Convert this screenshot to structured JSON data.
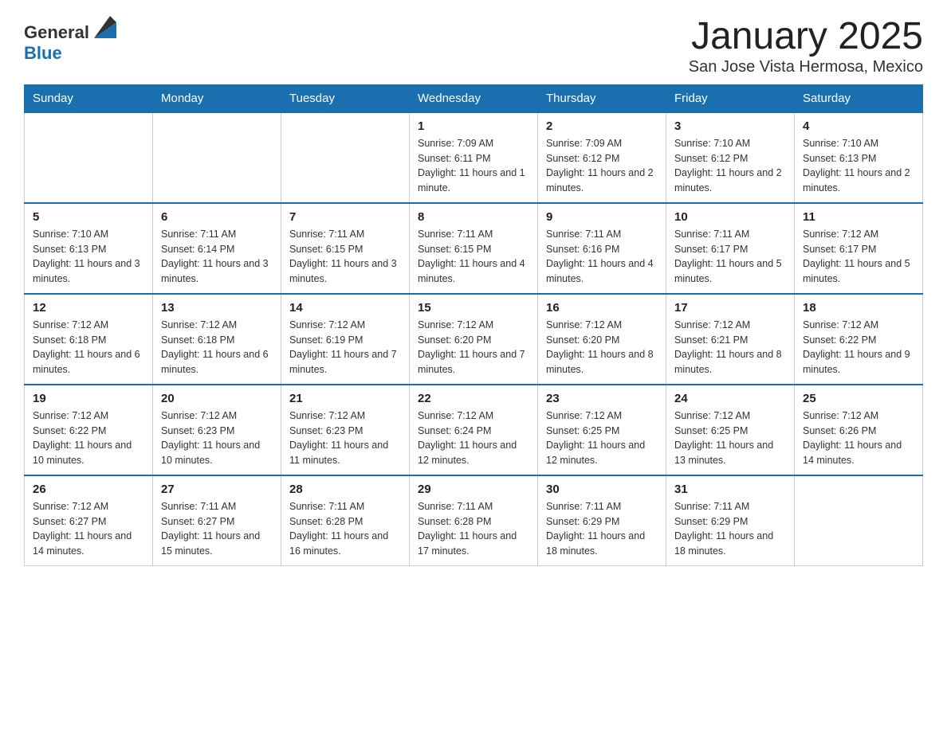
{
  "logo": {
    "text_general": "General",
    "text_blue": "Blue"
  },
  "header": {
    "month_title": "January 2025",
    "location": "San Jose Vista Hermosa, Mexico"
  },
  "days_of_week": [
    "Sunday",
    "Monday",
    "Tuesday",
    "Wednesday",
    "Thursday",
    "Friday",
    "Saturday"
  ],
  "weeks": [
    [
      {
        "day": "",
        "info": ""
      },
      {
        "day": "",
        "info": ""
      },
      {
        "day": "",
        "info": ""
      },
      {
        "day": "1",
        "info": "Sunrise: 7:09 AM\nSunset: 6:11 PM\nDaylight: 11 hours and 1 minute."
      },
      {
        "day": "2",
        "info": "Sunrise: 7:09 AM\nSunset: 6:12 PM\nDaylight: 11 hours and 2 minutes."
      },
      {
        "day": "3",
        "info": "Sunrise: 7:10 AM\nSunset: 6:12 PM\nDaylight: 11 hours and 2 minutes."
      },
      {
        "day": "4",
        "info": "Sunrise: 7:10 AM\nSunset: 6:13 PM\nDaylight: 11 hours and 2 minutes."
      }
    ],
    [
      {
        "day": "5",
        "info": "Sunrise: 7:10 AM\nSunset: 6:13 PM\nDaylight: 11 hours and 3 minutes."
      },
      {
        "day": "6",
        "info": "Sunrise: 7:11 AM\nSunset: 6:14 PM\nDaylight: 11 hours and 3 minutes."
      },
      {
        "day": "7",
        "info": "Sunrise: 7:11 AM\nSunset: 6:15 PM\nDaylight: 11 hours and 3 minutes."
      },
      {
        "day": "8",
        "info": "Sunrise: 7:11 AM\nSunset: 6:15 PM\nDaylight: 11 hours and 4 minutes."
      },
      {
        "day": "9",
        "info": "Sunrise: 7:11 AM\nSunset: 6:16 PM\nDaylight: 11 hours and 4 minutes."
      },
      {
        "day": "10",
        "info": "Sunrise: 7:11 AM\nSunset: 6:17 PM\nDaylight: 11 hours and 5 minutes."
      },
      {
        "day": "11",
        "info": "Sunrise: 7:12 AM\nSunset: 6:17 PM\nDaylight: 11 hours and 5 minutes."
      }
    ],
    [
      {
        "day": "12",
        "info": "Sunrise: 7:12 AM\nSunset: 6:18 PM\nDaylight: 11 hours and 6 minutes."
      },
      {
        "day": "13",
        "info": "Sunrise: 7:12 AM\nSunset: 6:18 PM\nDaylight: 11 hours and 6 minutes."
      },
      {
        "day": "14",
        "info": "Sunrise: 7:12 AM\nSunset: 6:19 PM\nDaylight: 11 hours and 7 minutes."
      },
      {
        "day": "15",
        "info": "Sunrise: 7:12 AM\nSunset: 6:20 PM\nDaylight: 11 hours and 7 minutes."
      },
      {
        "day": "16",
        "info": "Sunrise: 7:12 AM\nSunset: 6:20 PM\nDaylight: 11 hours and 8 minutes."
      },
      {
        "day": "17",
        "info": "Sunrise: 7:12 AM\nSunset: 6:21 PM\nDaylight: 11 hours and 8 minutes."
      },
      {
        "day": "18",
        "info": "Sunrise: 7:12 AM\nSunset: 6:22 PM\nDaylight: 11 hours and 9 minutes."
      }
    ],
    [
      {
        "day": "19",
        "info": "Sunrise: 7:12 AM\nSunset: 6:22 PM\nDaylight: 11 hours and 10 minutes."
      },
      {
        "day": "20",
        "info": "Sunrise: 7:12 AM\nSunset: 6:23 PM\nDaylight: 11 hours and 10 minutes."
      },
      {
        "day": "21",
        "info": "Sunrise: 7:12 AM\nSunset: 6:23 PM\nDaylight: 11 hours and 11 minutes."
      },
      {
        "day": "22",
        "info": "Sunrise: 7:12 AM\nSunset: 6:24 PM\nDaylight: 11 hours and 12 minutes."
      },
      {
        "day": "23",
        "info": "Sunrise: 7:12 AM\nSunset: 6:25 PM\nDaylight: 11 hours and 12 minutes."
      },
      {
        "day": "24",
        "info": "Sunrise: 7:12 AM\nSunset: 6:25 PM\nDaylight: 11 hours and 13 minutes."
      },
      {
        "day": "25",
        "info": "Sunrise: 7:12 AM\nSunset: 6:26 PM\nDaylight: 11 hours and 14 minutes."
      }
    ],
    [
      {
        "day": "26",
        "info": "Sunrise: 7:12 AM\nSunset: 6:27 PM\nDaylight: 11 hours and 14 minutes."
      },
      {
        "day": "27",
        "info": "Sunrise: 7:11 AM\nSunset: 6:27 PM\nDaylight: 11 hours and 15 minutes."
      },
      {
        "day": "28",
        "info": "Sunrise: 7:11 AM\nSunset: 6:28 PM\nDaylight: 11 hours and 16 minutes."
      },
      {
        "day": "29",
        "info": "Sunrise: 7:11 AM\nSunset: 6:28 PM\nDaylight: 11 hours and 17 minutes."
      },
      {
        "day": "30",
        "info": "Sunrise: 7:11 AM\nSunset: 6:29 PM\nDaylight: 11 hours and 18 minutes."
      },
      {
        "day": "31",
        "info": "Sunrise: 7:11 AM\nSunset: 6:29 PM\nDaylight: 11 hours and 18 minutes."
      },
      {
        "day": "",
        "info": ""
      }
    ]
  ]
}
